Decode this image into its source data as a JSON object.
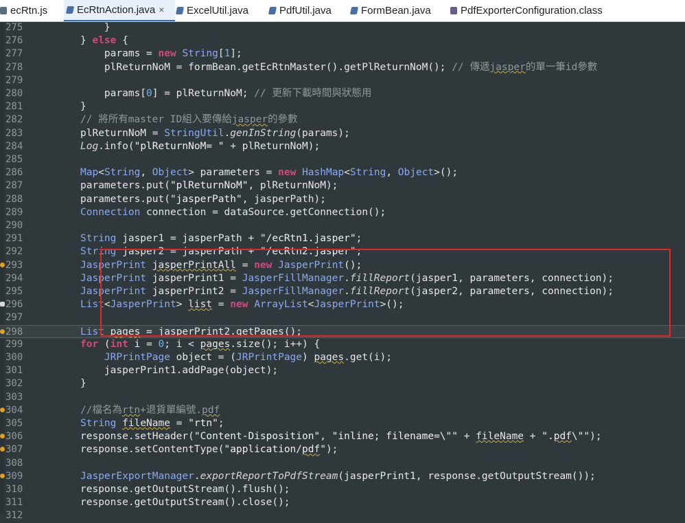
{
  "tabs": [
    {
      "label": "ecRtn.js",
      "icon": "js-file-icon",
      "active": false
    },
    {
      "label": "EcRtnAction.java",
      "icon": "java-file-icon",
      "active": true
    },
    {
      "label": "ExcelUtil.java",
      "icon": "java-file-icon",
      "active": false
    },
    {
      "label": "PdfUtil.java",
      "icon": "java-file-icon",
      "active": false
    },
    {
      "label": "FormBean.java",
      "icon": "java-file-icon",
      "active": false
    },
    {
      "label": "PdfExporterConfiguration.class",
      "icon": "class-file-icon",
      "active": false
    }
  ],
  "tab_close_glyph": "×",
  "editor": {
    "current_line": 298,
    "highlight_box_lines": [
      291,
      296
    ],
    "lines": [
      {
        "n": "275",
        "text": "            }"
      },
      {
        "n": "276",
        "text": "        } else {"
      },
      {
        "n": "277",
        "text": "            params = new String[1];"
      },
      {
        "n": "278",
        "text": "            plReturnNoM = formBean.getEcRtnMaster().getPlReturnNoM(); // 傳遞jasper的單一筆id參數"
      },
      {
        "n": "279",
        "text": ""
      },
      {
        "n": "280",
        "text": "            params[0] = plReturnNoM; // 更新下載時間與狀態用"
      },
      {
        "n": "281",
        "text": "        }"
      },
      {
        "n": "282",
        "text": "        // 將所有master ID組入要傳給jasper的參數"
      },
      {
        "n": "283",
        "text": "        plReturnNoM = StringUtil.genInString(params);"
      },
      {
        "n": "284",
        "text": "        Log.info(\"plReturnNoM= \" + plReturnNoM);"
      },
      {
        "n": "285",
        "text": ""
      },
      {
        "n": "286",
        "text": "        Map<String, Object> parameters = new HashMap<String, Object>();"
      },
      {
        "n": "287",
        "text": "        parameters.put(\"plReturnNoM\", plReturnNoM);"
      },
      {
        "n": "288",
        "text": "        parameters.put(\"jasperPath\", jasperPath);"
      },
      {
        "n": "289",
        "text": "        Connection connection = dataSource.getConnection();"
      },
      {
        "n": "290",
        "text": ""
      },
      {
        "n": "291",
        "text": "        String jasper1 = jasperPath + \"/ecRtn1.jasper\";"
      },
      {
        "n": "292",
        "text": "        String jasper2 = jasperPath + \"/ecRtn2.jasper\";"
      },
      {
        "n": "293",
        "text": "        JasperPrint jasperPrintAll = new JasperPrint();"
      },
      {
        "n": "294",
        "text": "        JasperPrint jasperPrint1 = JasperFillManager.fillReport(jasper1, parameters, connection);"
      },
      {
        "n": "295",
        "text": "        JasperPrint jasperPrint2 = JasperFillManager.fillReport(jasper2, parameters, connection);"
      },
      {
        "n": "296",
        "text": "        List<JasperPrint> list = new ArrayList<JasperPrint>();"
      },
      {
        "n": "297",
        "text": ""
      },
      {
        "n": "298",
        "text": "        List pages = jasperPrint2.getPages();"
      },
      {
        "n": "299",
        "text": "        for (int i = 0; i < pages.size(); i++) {"
      },
      {
        "n": "300",
        "text": "            JRPrintPage object = (JRPrintPage) pages.get(i);"
      },
      {
        "n": "301",
        "text": "            jasperPrint1.addPage(object);"
      },
      {
        "n": "302",
        "text": "        }"
      },
      {
        "n": "303",
        "text": ""
      },
      {
        "n": "304",
        "text": "        //檔名為rtn+退貨單編號.pdf"
      },
      {
        "n": "305",
        "text": "        String fileName = \"rtn\";"
      },
      {
        "n": "306",
        "text": "        response.setHeader(\"Content-Disposition\", \"inline; filename=\\\"\" + fileName + \".pdf\\\"\");"
      },
      {
        "n": "307",
        "text": "        response.setContentType(\"application/pdf\");"
      },
      {
        "n": "308",
        "text": ""
      },
      {
        "n": "309",
        "text": "        JasperExportManager.exportReportToPdfStream(jasperPrint1, response.getOutputStream());"
      },
      {
        "n": "310",
        "text": "        response.getOutputStream().flush();"
      },
      {
        "n": "311",
        "text": "        response.getOutputStream().close();"
      },
      {
        "n": "312",
        "text": ""
      }
    ]
  },
  "colors": {
    "editor_bg": "#2f393c",
    "keyword": "#d4477e",
    "type": "#8ba8f0",
    "comment": "#8d999c",
    "highlight_box": "#e3262a"
  }
}
